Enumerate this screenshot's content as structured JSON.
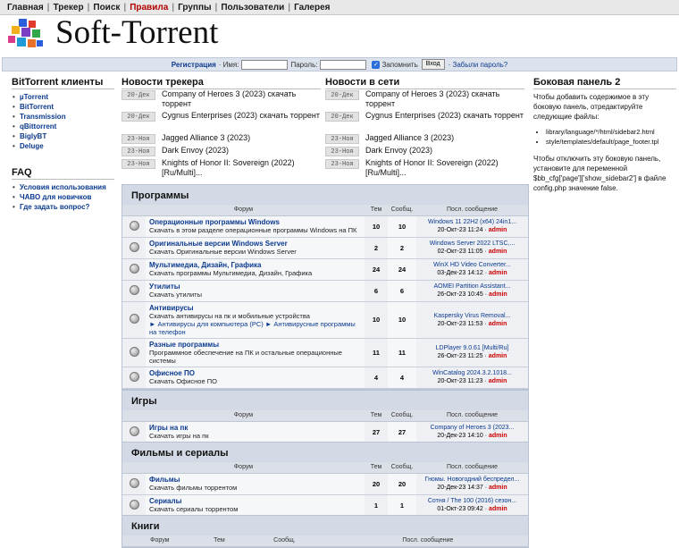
{
  "nav": {
    "items": [
      {
        "label": "Главная"
      },
      {
        "label": "Трекер"
      },
      {
        "label": "Поиск"
      },
      {
        "label": "Правила",
        "active": true
      },
      {
        "label": "Группы"
      },
      {
        "label": "Пользователи"
      },
      {
        "label": "Галерея"
      }
    ]
  },
  "brand": {
    "title": "Soft-Torrent",
    "logo_icon": "colored-cubes-logo"
  },
  "login": {
    "register": "Регистрация",
    "name_label": "· Имя:",
    "pass_label": "Пароль:",
    "remember": "Запомнить",
    "submit": "Вход",
    "forgot": "· Забыли пароль?",
    "name_value": "",
    "pass_value": ""
  },
  "left": {
    "clients_title": "BitTorrent клиенты",
    "clients": [
      "µTorrent",
      "BitTorrent",
      "Transmission",
      "qBittorrent",
      "BiglyBT",
      "Deluge"
    ],
    "faq_title": "FAQ",
    "faq": [
      "Условия использования",
      "ЧАВО для новичков",
      "Где задать вопрос?"
    ]
  },
  "news_tracker": {
    "title": "Новости трекера",
    "items": [
      {
        "date": "20-Дек",
        "title": "Company of Heroes 3 (2023) скачать торрент"
      },
      {
        "date": "20-Дек",
        "title": "Cygnus Enterprises (2023) скачать торрент"
      },
      {
        "date": "23-Ноя",
        "title": "Jagged Alliance 3 (2023)"
      },
      {
        "date": "23-Ноя",
        "title": "Dark Envoy (2023)"
      },
      {
        "date": "23-Ноя",
        "title": "Knights of Honor II: Sovereign (2022) [Ru/Multi]..."
      }
    ]
  },
  "news_net": {
    "title": "Новости в сети",
    "items": [
      {
        "date": "20-Дек",
        "title": "Company of Heroes 3 (2023) скачать торрент"
      },
      {
        "date": "20-Дек",
        "title": "Cygnus Enterprises (2023) скачать торрент"
      },
      {
        "date": "23-Ноя",
        "title": "Jagged Alliance 3 (2023)"
      },
      {
        "date": "23-Ноя",
        "title": "Dark Envoy (2023)"
      },
      {
        "date": "23-Ноя",
        "title": "Knights of Honor II: Sovereign (2022) [Ru/Multi]..."
      }
    ]
  },
  "sidebar2": {
    "title": "Боковая панель 2",
    "p1": "Чтобы добавить содержимое в эту боковую панель, отредактируйте следующие файлы:",
    "files": [
      "library/language/*/html/sidebar2.html",
      "style/templates/default/page_footer.tpl"
    ],
    "p2": "Чтобы отключить эту боковую панель, установите для переменной $bb_cfg['page']['show_sidebar2'] в файле config.php значение false."
  },
  "table_headers": {
    "forum": "Форум",
    "topics": "Тем",
    "posts": "Сообщ.",
    "last": "Посл. сообщение"
  },
  "categories": [
    {
      "title": "Программы",
      "forums": [
        {
          "name": "Операционные программы Windows",
          "desc": "Скачать в этом разделе операционные программы Windows на ПК",
          "topics": "10",
          "posts": "10",
          "last_title": "Windows 11 22H2 (x64) 24in1...",
          "last_date": "20-Окт-23 11:24",
          "last_user": "admin"
        },
        {
          "name": "Оригинальные версии Windows Server",
          "desc": "Скачать Оригинальные версии Windows Server",
          "topics": "2",
          "posts": "2",
          "last_title": "Windows Server 2022 LTSC,...",
          "last_date": "02-Окт-23 11:05",
          "last_user": "admin"
        },
        {
          "name": "Мультимедиа, Дизайн, Графика",
          "desc": "Скачать программы Мультимедиа, Дизайн, Графика",
          "topics": "24",
          "posts": "24",
          "last_title": "WinX HD Video Converter...",
          "last_date": "03-Дек-23 14:12",
          "last_user": "admin"
        },
        {
          "name": "Утилиты",
          "desc": "Скачать утилиты",
          "topics": "6",
          "posts": "6",
          "last_title": "AOMEI Partition Assistant...",
          "last_date": "26-Окт-23 10:45",
          "last_user": "admin"
        },
        {
          "name": "Антивирусы",
          "desc": "Скачать антивирусы на пк и мобильные устройства",
          "sub": "► Антивирусы для компьютера (PC)  ► Антивирусные программы на телефон",
          "topics": "10",
          "posts": "10",
          "last_title": "Kaspersky Virus Removal...",
          "last_date": "20-Окт-23 11:53",
          "last_user": "admin"
        },
        {
          "name": "Разные программы",
          "desc": "Программное обеспечение на ПК и остальные операционные системы",
          "topics": "11",
          "posts": "11",
          "last_title": "LDPlayer 9.0.61 [Multi/Ru]",
          "last_date": "26-Окт-23 11:25",
          "last_user": "admin"
        },
        {
          "name": "Офисное ПО",
          "desc": "Скачать Офисное ПО",
          "topics": "4",
          "posts": "4",
          "last_title": "WinCatalog 2024.3.2.1018...",
          "last_date": "20-Окт-23 11:23",
          "last_user": "admin"
        }
      ]
    },
    {
      "title": "Игры",
      "forums": [
        {
          "name": "Игры на пк",
          "desc": "Скачать игры на пк",
          "topics": "27",
          "posts": "27",
          "last_title": "Company of Heroes 3 (2023...",
          "last_date": "20-Дек-23 14:10",
          "last_user": "admin"
        }
      ]
    },
    {
      "title": "Фильмы и сериалы",
      "forums": [
        {
          "name": "Фильмы",
          "desc": "Скачать фильмы торрентом",
          "topics": "20",
          "posts": "20",
          "last_title": "Гномы. Новогодний беспредел...",
          "last_date": "20-Дек-23 14:37",
          "last_user": "admin"
        },
        {
          "name": "Сериалы",
          "desc": "Скачать сериалы торрентом",
          "topics": "1",
          "posts": "1",
          "last_title": "Сотня / The 100 (2016) сезон...",
          "last_date": "01-Окт-23 09:42",
          "last_user": "admin"
        }
      ]
    },
    {
      "title": "Книги",
      "forums": []
    }
  ]
}
